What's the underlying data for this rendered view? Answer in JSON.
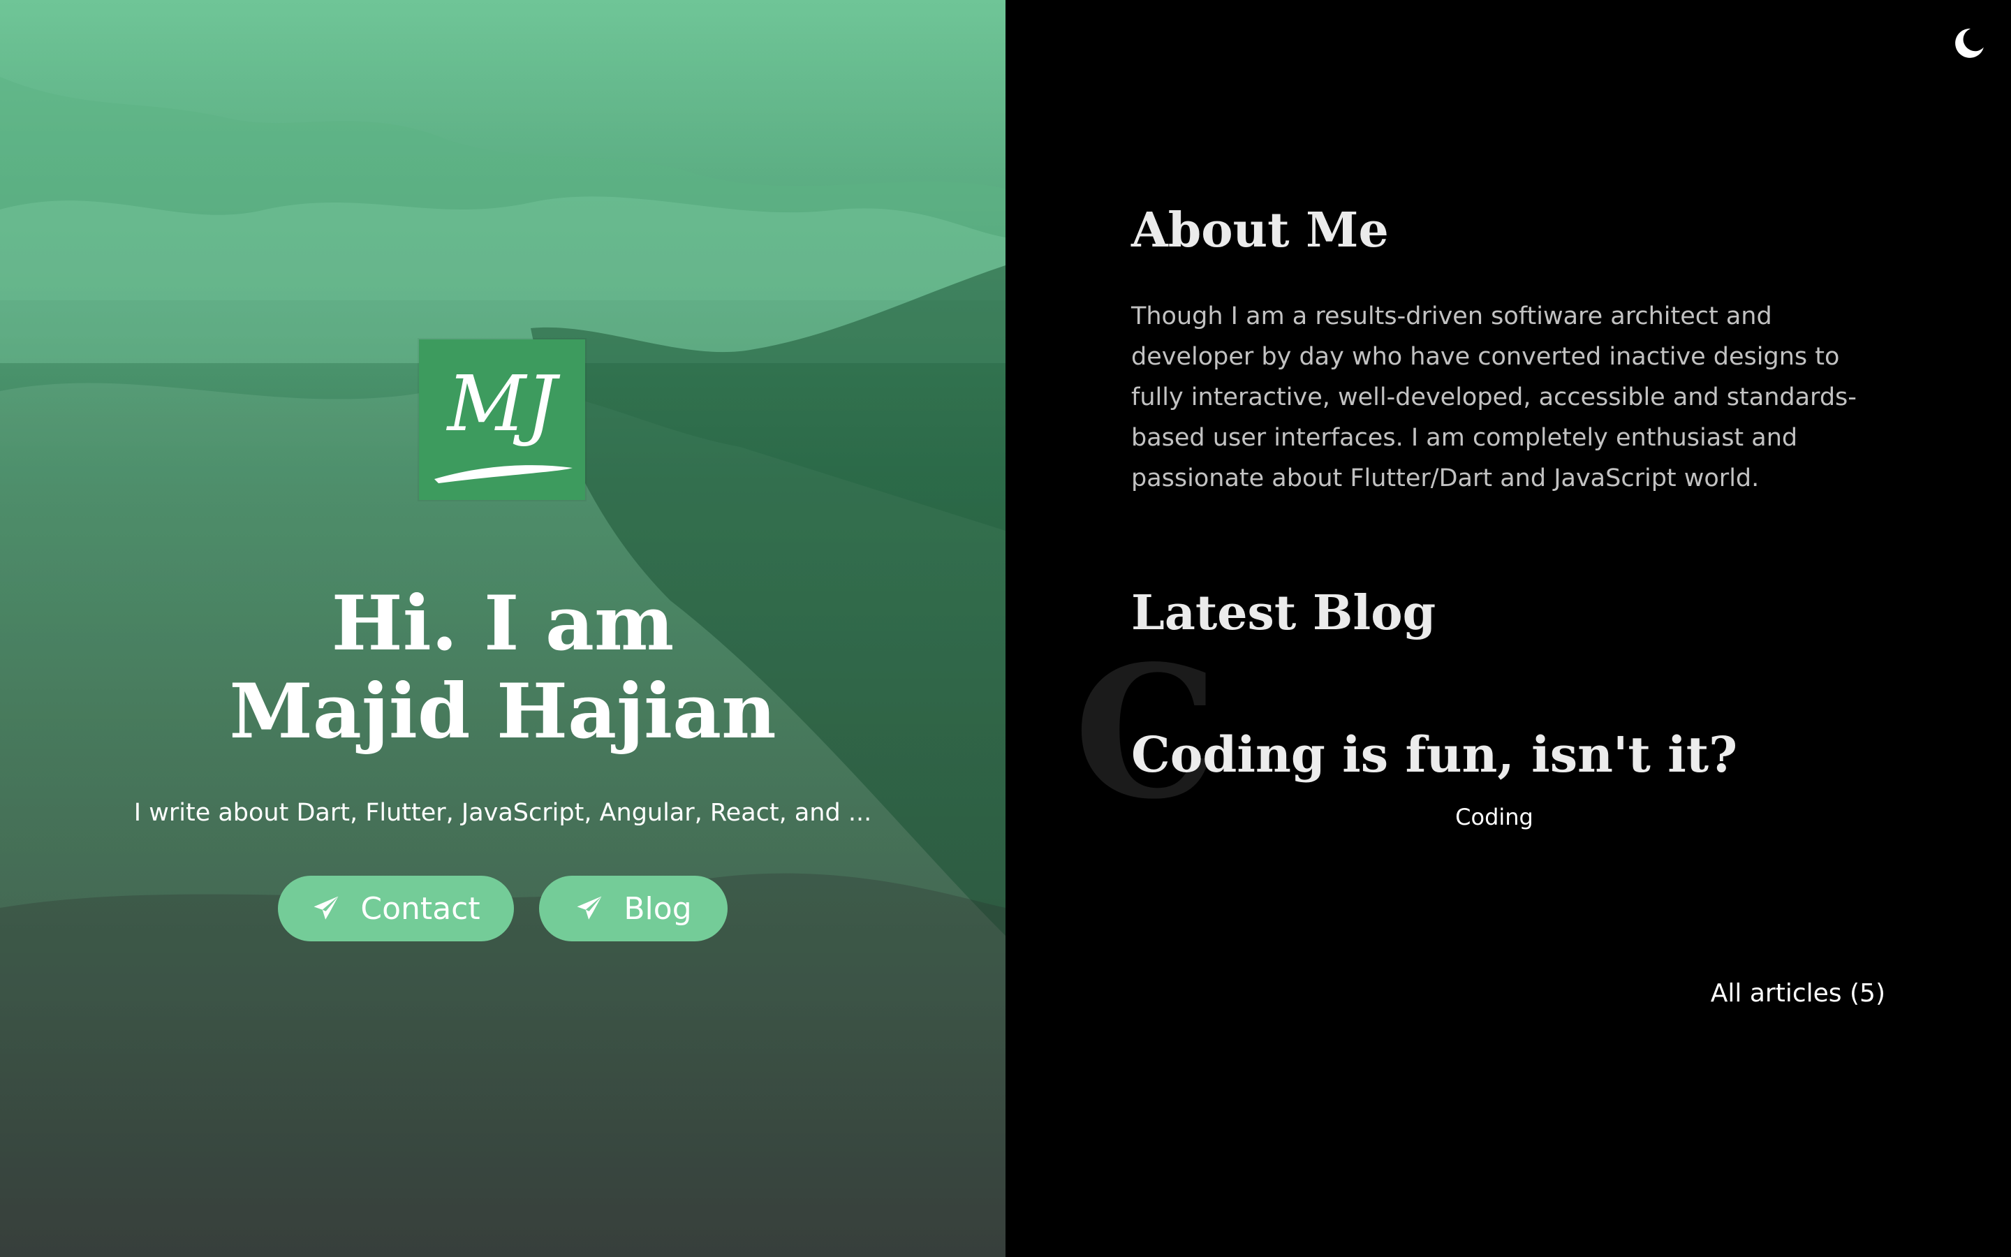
{
  "hero": {
    "logo_text": "MJ",
    "title_line1": "Hi. I am",
    "title_line2": "Majid Hajian",
    "subtitle": "I write about Dart, Flutter, JavaScript, Angular, React, and ...",
    "buttons": [
      {
        "label": "Contact",
        "icon": "paper-plane-icon"
      },
      {
        "label": "Blog",
        "icon": "paper-plane-icon"
      }
    ],
    "colors": {
      "accent": "#74cc98",
      "logo_bg": "#3d9b5e"
    }
  },
  "header": {
    "theme_toggle_icon": "moon-icon"
  },
  "about": {
    "heading": "About Me",
    "body": "Though I am a results-driven softiware architect and developer by day who have converted inactive designs to fully interactive, well-developed, accessible and standards-based user interfaces. I am completely enthusiast and passionate about Flutter/Dart and JavaScript world."
  },
  "latest_blog": {
    "heading": "Latest Blog",
    "post": {
      "initial": "C",
      "title": "Coding is fun, isn't it?",
      "category": "Coding"
    },
    "all_articles_label": "All articles (5)"
  }
}
